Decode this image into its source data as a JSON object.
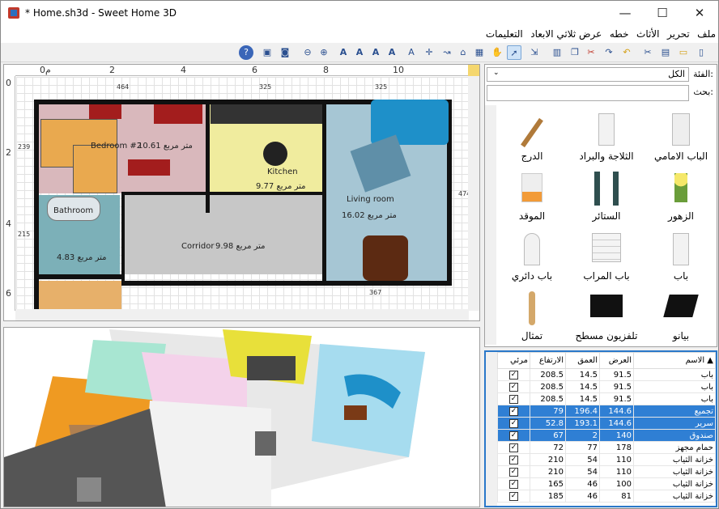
{
  "window": {
    "title": "* Home.sh3d - Sweet Home 3D",
    "minimize": "—",
    "maximize": "☐",
    "close": "✕"
  },
  "menu": [
    "ملف",
    "تحرير",
    "الأثاث",
    "خطه",
    "عرض ثلاثي الابعاد",
    "التعليمات"
  ],
  "toolbar": {
    "icons": [
      "new",
      "open",
      "save",
      "cut",
      "copy",
      "paste",
      "undo",
      "redo",
      "delete",
      "select",
      "pan",
      "create-walls",
      "create-rooms",
      "create-dimensions",
      "add-text",
      "text-style",
      "zoom-in",
      "zoom-out",
      "preferences",
      "camera",
      "help"
    ]
  },
  "plan": {
    "ruler_top": [
      "0م",
      "2",
      "4",
      "6",
      "8",
      "10"
    ],
    "ruler_left": [
      "0",
      "2",
      "4",
      "6"
    ],
    "dims": {
      "top_a": "464",
      "top_b": "325",
      "top_c": "325",
      "left_a": "239",
      "left_b": "215",
      "right_a": "474",
      "bottom_a": "367"
    },
    "rooms": [
      {
        "name": "Bedroom #2",
        "area": "10.61 متر مربع"
      },
      {
        "name": "Kitchen",
        "area": "9.77 متر مربع"
      },
      {
        "name": "Living room",
        "area": "16.02 متر مربع"
      },
      {
        "name": "Bathroom",
        "area": "4.83 متر مربع"
      },
      {
        "name": "Corridor",
        "area": "9.98 متر مربع"
      }
    ]
  },
  "catalog": {
    "category_label": "الفئة:",
    "category_value": "الكل",
    "search_label": "بحث:",
    "search_value": "",
    "items": [
      {
        "label": "الباب الامامي",
        "icon": "door-icon"
      },
      {
        "label": "الثلاجة والبراد",
        "icon": "fridge-icon"
      },
      {
        "label": "الدرج",
        "icon": "stairs-icon"
      },
      {
        "label": "الزهور",
        "icon": "flowers-icon"
      },
      {
        "label": "الستائر",
        "icon": "curtains-icon"
      },
      {
        "label": "الموقد",
        "icon": "fireplace-icon"
      },
      {
        "label": "باب",
        "icon": "door-icon"
      },
      {
        "label": "باب المراب",
        "icon": "garage-door-icon"
      },
      {
        "label": "باب دائري",
        "icon": "round-door-icon"
      },
      {
        "label": "بيانو",
        "icon": "piano-icon"
      },
      {
        "label": "تلفزيون مسطح",
        "icon": "tv-icon"
      },
      {
        "label": "تمثال",
        "icon": "statue-icon"
      }
    ]
  },
  "furniture": {
    "headers": [
      "الاسم",
      "العرض",
      "العمق",
      "الارتفاع",
      "مرئي"
    ],
    "rows": [
      {
        "name": "باب",
        "w": "91.5",
        "d": "14.5",
        "h": "208.5",
        "visible": true,
        "sel": false
      },
      {
        "name": "باب",
        "w": "91.5",
        "d": "14.5",
        "h": "208.5",
        "visible": true,
        "sel": false
      },
      {
        "name": "باب",
        "w": "91.5",
        "d": "14.5",
        "h": "208.5",
        "visible": true,
        "sel": false
      },
      {
        "name": "تجميع",
        "w": "144.6",
        "d": "196.4",
        "h": "79",
        "visible": true,
        "sel": true
      },
      {
        "name": "سرير",
        "w": "144.6",
        "d": "193.1",
        "h": "52.8",
        "visible": true,
        "sel": true
      },
      {
        "name": "صندوق",
        "w": "140",
        "d": "2",
        "h": "67",
        "visible": true,
        "sel": true
      },
      {
        "name": "حمام مجهز",
        "w": "178",
        "d": "77",
        "h": "72",
        "visible": true,
        "sel": false
      },
      {
        "name": "خزانة الثياب",
        "w": "110",
        "d": "54",
        "h": "210",
        "visible": true,
        "sel": false
      },
      {
        "name": "خزانة الثياب",
        "w": "110",
        "d": "54",
        "h": "210",
        "visible": true,
        "sel": false
      },
      {
        "name": "خزانة الثياب",
        "w": "100",
        "d": "46",
        "h": "165",
        "visible": true,
        "sel": false
      },
      {
        "name": "خزانة الثياب",
        "w": "81",
        "d": "46",
        "h": "185",
        "visible": true,
        "sel": false
      }
    ]
  }
}
